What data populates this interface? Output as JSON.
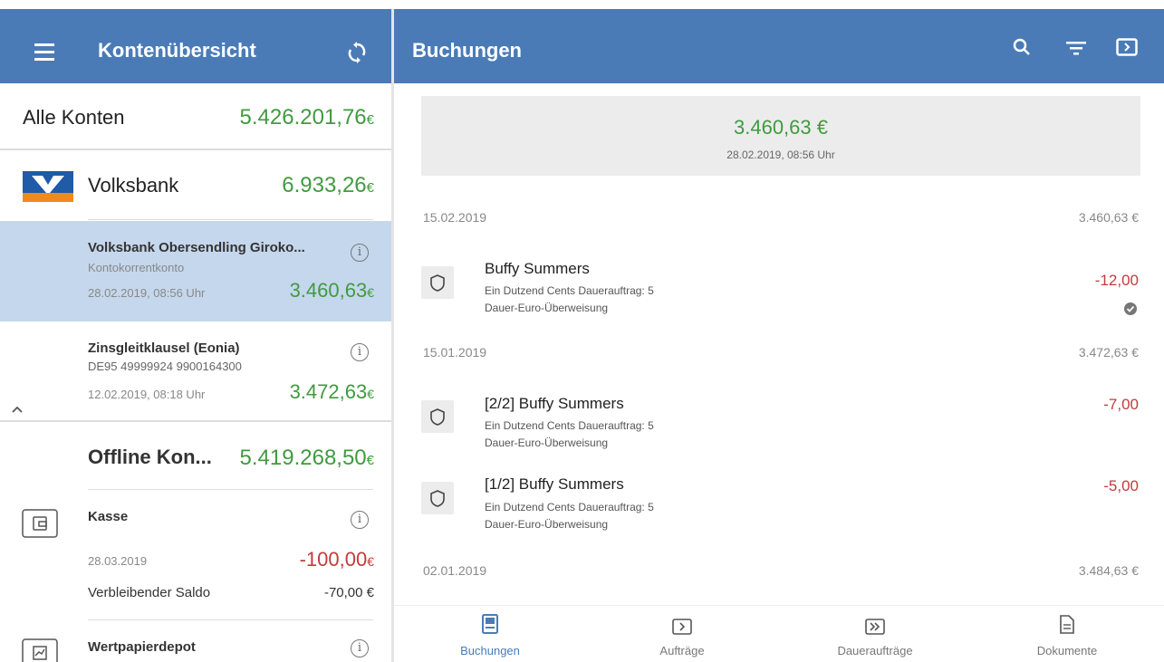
{
  "left_panel": {
    "title": "Kontenübersicht",
    "all_accounts": {
      "label": "Alle Konten",
      "amount": "5.426.201,76",
      "currency": "€"
    },
    "bank": {
      "name": "Volksbank",
      "amount": "6.933,26",
      "currency": "€"
    },
    "accounts": [
      {
        "name": "Volksbank Obersendling Giroko...",
        "subtitle": "Kontokorrentkonto",
        "date": "28.02.2019, 08:56 Uhr",
        "amount": "3.460,63",
        "currency": "€"
      },
      {
        "name": "Zinsgleitklausel (Eonia)",
        "subtitle": "DE95 49999924 9900164300",
        "date": "12.02.2019, 08:18 Uhr",
        "amount": "3.472,63",
        "currency": "€"
      }
    ],
    "offline": {
      "name": "Offline Kon...",
      "amount": "5.419.268,50",
      "currency": "€"
    },
    "offline_accounts": [
      {
        "name": "Kasse",
        "date": "28.03.2019",
        "amount": "-100,00",
        "currency": "€",
        "remaining_label": "Verbleibender Saldo",
        "remaining_value": "-70,00 €"
      },
      {
        "name": "Wertpapierdepot"
      }
    ]
  },
  "right_panel": {
    "title": "Buchungen",
    "summary": {
      "amount": "3.460,63 €",
      "date": "28.02.2019, 08:56 Uhr"
    },
    "groups": [
      {
        "date": "15.02.2019",
        "balance": "3.460,63 €"
      },
      {
        "date": "15.01.2019",
        "balance": "3.472,63 €"
      },
      {
        "date": "02.01.2019",
        "balance": "3.484,63 €"
      }
    ],
    "transactions": [
      {
        "title": "Buffy Summers",
        "line1": "Ein Dutzend Cents Dauerauftrag: 5",
        "line2": "Dauer-Euro-Überweisung",
        "amount": "-12,00"
      },
      {
        "title": "[2/2] Buffy Summers",
        "line1": "Ein Dutzend Cents Dauerauftrag: 5",
        "line2": "Dauer-Euro-Überweisung",
        "amount": "-7,00"
      },
      {
        "title": "[1/2] Buffy Summers",
        "line1": "Ein Dutzend Cents Dauerauftrag: 5",
        "line2": "Dauer-Euro-Überweisung",
        "amount": "-5,00"
      }
    ],
    "nav": [
      "Buchungen",
      "Aufträge",
      "Daueraufträge",
      "Dokumente"
    ]
  },
  "colors": {
    "appbar": "#4a7bb7",
    "positive": "#3f9b3f",
    "negative": "#c23b3b",
    "selected": "#c5d7ec"
  }
}
